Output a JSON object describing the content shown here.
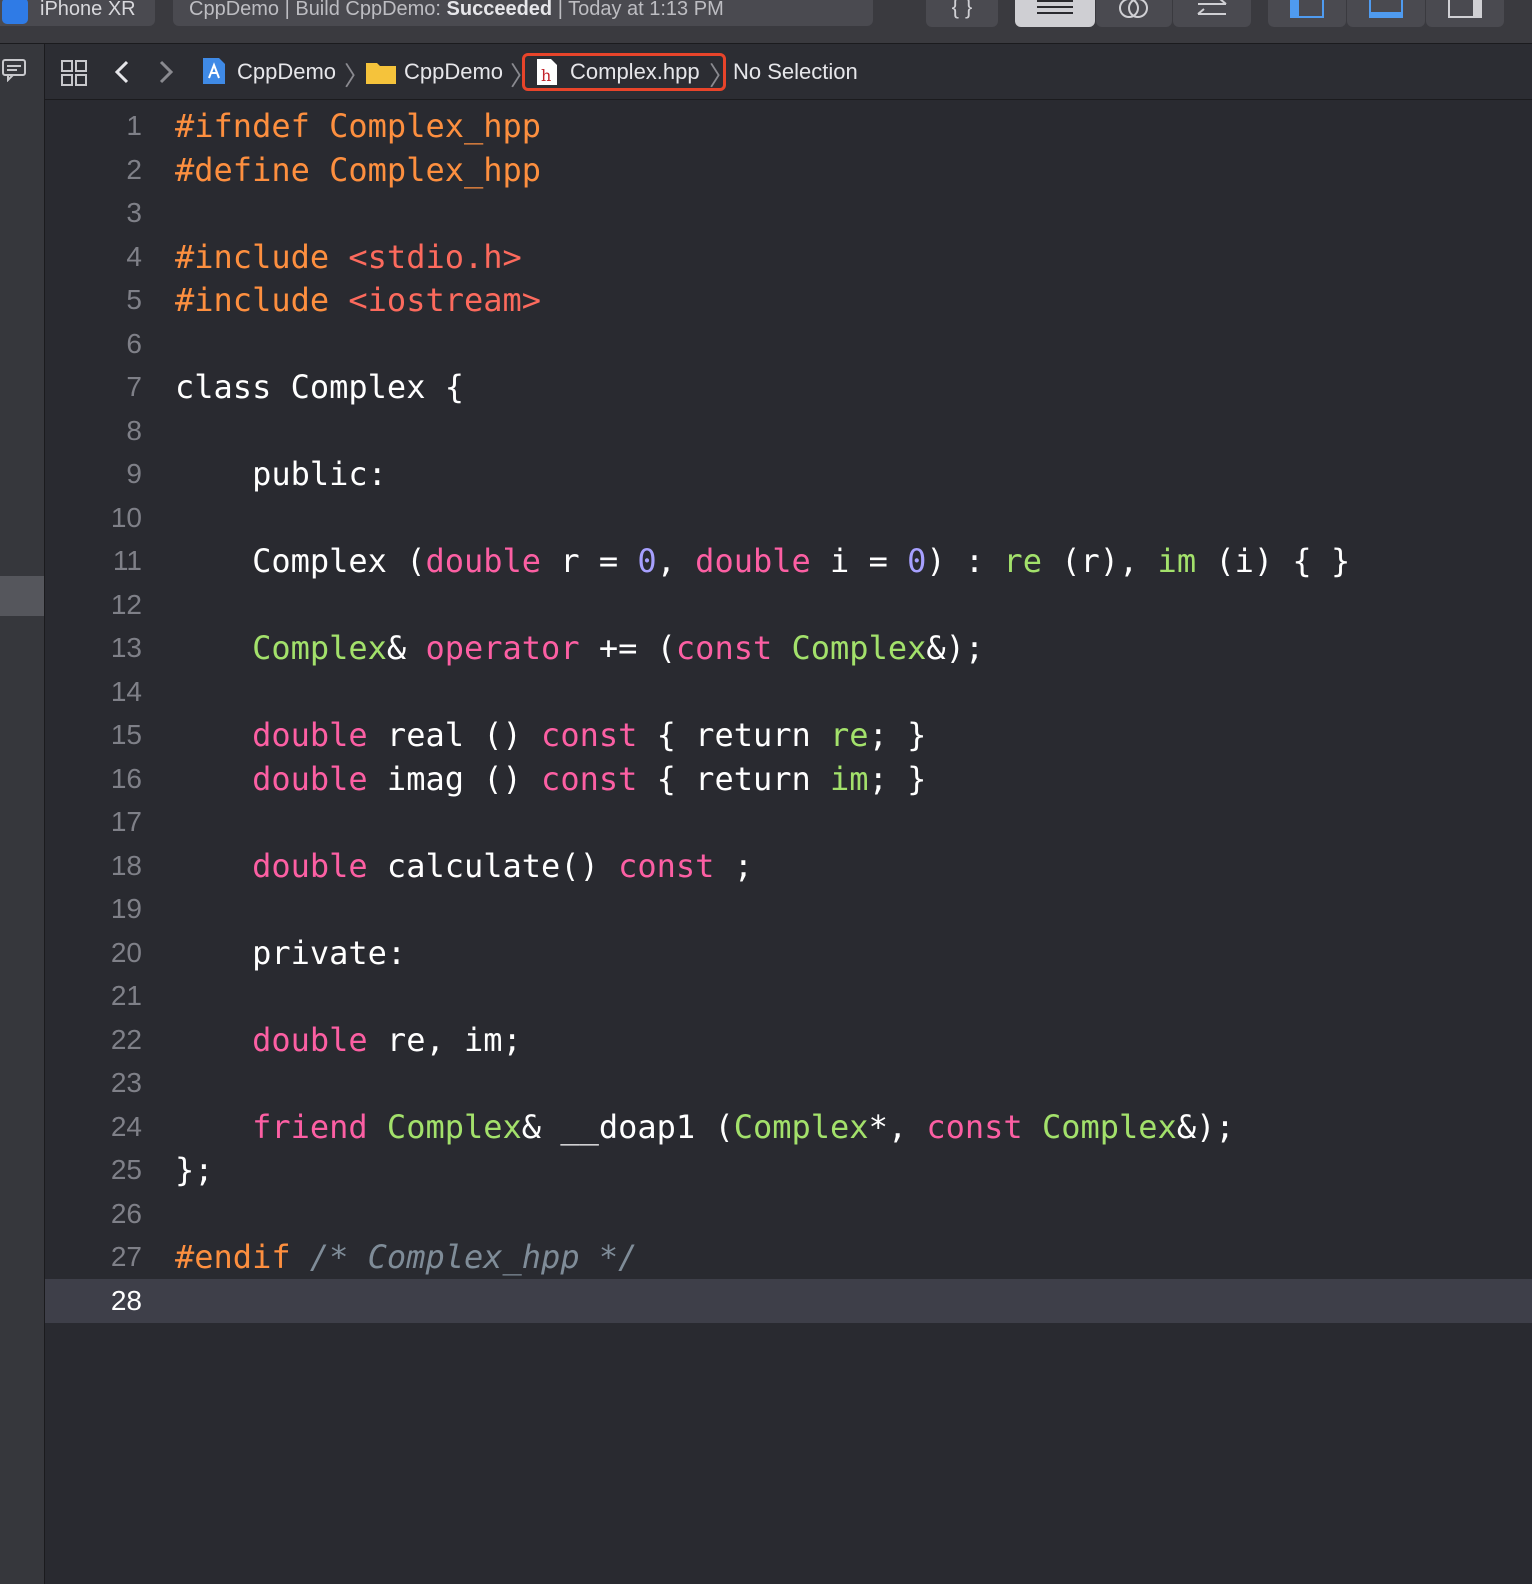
{
  "toolbar": {
    "device_label": "iPhone XR",
    "status_prefix": "CppDemo | Build CppDemo: ",
    "status_result": "Succeeded",
    "status_suffix": " | Today at 1:13 PM",
    "braces_label": "{ }"
  },
  "jumpbar": {
    "breadcrumbs": [
      "CppDemo",
      "CppDemo",
      "Complex.hpp",
      "No Selection"
    ],
    "file_glyph": "h"
  },
  "editor": {
    "current_line": 28,
    "lines": [
      {
        "n": "1",
        "tokens": [
          {
            "c": "tok-pp",
            "t": "#ifndef Complex_hpp"
          }
        ]
      },
      {
        "n": "2",
        "tokens": [
          {
            "c": "tok-pp",
            "t": "#define Complex_hpp"
          }
        ]
      },
      {
        "n": "3",
        "tokens": []
      },
      {
        "n": "4",
        "tokens": [
          {
            "c": "tok-pp",
            "t": "#include "
          },
          {
            "c": "tok-str",
            "t": "<stdio.h>"
          }
        ]
      },
      {
        "n": "5",
        "tokens": [
          {
            "c": "tok-pp",
            "t": "#include "
          },
          {
            "c": "tok-str",
            "t": "<iostream>"
          }
        ]
      },
      {
        "n": "6",
        "tokens": []
      },
      {
        "n": "7",
        "tokens": [
          {
            "c": "tok-plain",
            "t": "class Complex {"
          }
        ]
      },
      {
        "n": "8",
        "tokens": []
      },
      {
        "n": "9",
        "tokens": [
          {
            "c": "tok-plain",
            "t": "    public:"
          }
        ]
      },
      {
        "n": "10",
        "tokens": []
      },
      {
        "n": "11",
        "tokens": [
          {
            "c": "tok-plain",
            "t": "    Complex ("
          },
          {
            "c": "tok-kw",
            "t": "double"
          },
          {
            "c": "tok-plain",
            "t": " r = "
          },
          {
            "c": "tok-num2",
            "t": "0"
          },
          {
            "c": "tok-plain",
            "t": ", "
          },
          {
            "c": "tok-kw",
            "t": "double"
          },
          {
            "c": "tok-plain",
            "t": " i = "
          },
          {
            "c": "tok-num2",
            "t": "0"
          },
          {
            "c": "tok-plain",
            "t": ") : "
          },
          {
            "c": "tok-cls",
            "t": "re"
          },
          {
            "c": "tok-plain",
            "t": " (r), "
          },
          {
            "c": "tok-cls",
            "t": "im"
          },
          {
            "c": "tok-plain",
            "t": " (i) { }"
          }
        ]
      },
      {
        "n": "12",
        "tokens": []
      },
      {
        "n": "13",
        "tokens": [
          {
            "c": "tok-plain",
            "t": "    "
          },
          {
            "c": "tok-cls",
            "t": "Complex"
          },
          {
            "c": "tok-plain",
            "t": "& "
          },
          {
            "c": "tok-kw",
            "t": "operator"
          },
          {
            "c": "tok-plain",
            "t": " += ("
          },
          {
            "c": "tok-kw",
            "t": "const"
          },
          {
            "c": "tok-plain",
            "t": " "
          },
          {
            "c": "tok-cls",
            "t": "Complex"
          },
          {
            "c": "tok-plain",
            "t": "&);"
          }
        ]
      },
      {
        "n": "14",
        "tokens": []
      },
      {
        "n": "15",
        "tokens": [
          {
            "c": "tok-plain",
            "t": "    "
          },
          {
            "c": "tok-kw",
            "t": "double"
          },
          {
            "c": "tok-plain",
            "t": " real () "
          },
          {
            "c": "tok-kw",
            "t": "const"
          },
          {
            "c": "tok-plain",
            "t": " { return "
          },
          {
            "c": "tok-cls",
            "t": "re"
          },
          {
            "c": "tok-plain",
            "t": "; }"
          }
        ]
      },
      {
        "n": "16",
        "tokens": [
          {
            "c": "tok-plain",
            "t": "    "
          },
          {
            "c": "tok-kw",
            "t": "double"
          },
          {
            "c": "tok-plain",
            "t": " imag () "
          },
          {
            "c": "tok-kw",
            "t": "const"
          },
          {
            "c": "tok-plain",
            "t": " { return "
          },
          {
            "c": "tok-cls",
            "t": "im"
          },
          {
            "c": "tok-plain",
            "t": "; }"
          }
        ]
      },
      {
        "n": "17",
        "tokens": []
      },
      {
        "n": "18",
        "tokens": [
          {
            "c": "tok-plain",
            "t": "    "
          },
          {
            "c": "tok-kw",
            "t": "double"
          },
          {
            "c": "tok-plain",
            "t": " calculate() "
          },
          {
            "c": "tok-kw",
            "t": "const"
          },
          {
            "c": "tok-plain",
            "t": " ;"
          }
        ]
      },
      {
        "n": "19",
        "tokens": []
      },
      {
        "n": "20",
        "tokens": [
          {
            "c": "tok-plain",
            "t": "    private:"
          }
        ]
      },
      {
        "n": "21",
        "tokens": []
      },
      {
        "n": "22",
        "tokens": [
          {
            "c": "tok-plain",
            "t": "    "
          },
          {
            "c": "tok-kw",
            "t": "double"
          },
          {
            "c": "tok-plain",
            "t": " re, im;"
          }
        ]
      },
      {
        "n": "23",
        "tokens": []
      },
      {
        "n": "24",
        "tokens": [
          {
            "c": "tok-plain",
            "t": "    "
          },
          {
            "c": "tok-kw",
            "t": "friend"
          },
          {
            "c": "tok-plain",
            "t": " "
          },
          {
            "c": "tok-cls",
            "t": "Complex"
          },
          {
            "c": "tok-plain",
            "t": "& __doap1 ("
          },
          {
            "c": "tok-cls",
            "t": "Complex"
          },
          {
            "c": "tok-plain",
            "t": "*, "
          },
          {
            "c": "tok-kw",
            "t": "const"
          },
          {
            "c": "tok-plain",
            "t": " "
          },
          {
            "c": "tok-cls",
            "t": "Complex"
          },
          {
            "c": "tok-plain",
            "t": "&);"
          }
        ]
      },
      {
        "n": "25",
        "tokens": [
          {
            "c": "tok-plain",
            "t": "};"
          }
        ]
      },
      {
        "n": "26",
        "tokens": []
      },
      {
        "n": "27",
        "tokens": [
          {
            "c": "tok-pp",
            "t": "#endif "
          },
          {
            "c": "tok-cmt",
            "t": "/* Complex_hpp */"
          }
        ]
      },
      {
        "n": "28",
        "tokens": []
      }
    ]
  },
  "colors": {
    "preprocessor": "#fd8f3f",
    "string": "#fc6a5d",
    "keyword": "#fc5fa3",
    "number": "#a7a0ff",
    "type": "#a3e16b",
    "comment": "#7f8c98",
    "highlight_box": "#e8442a"
  }
}
